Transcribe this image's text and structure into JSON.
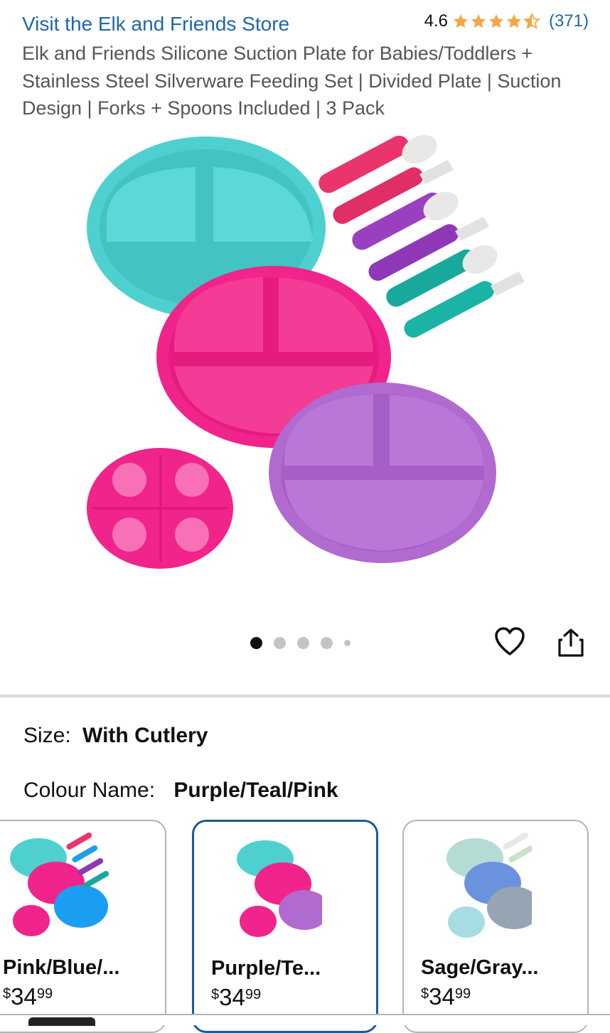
{
  "store_link": "Visit the Elk and Friends Store",
  "rating": {
    "value": "4.6",
    "stars": 4.6,
    "count": "(371)"
  },
  "product_title": "Elk and Friends Silicone Suction Plate for Babies/Toddlers + Stainless Steel Silverware Feeding Set | Divided Plate | Suction Design | Forks + Spoons Included | 3 Pack",
  "carousel": {
    "total": 5,
    "active": 1
  },
  "size": {
    "label": "Size:",
    "value": "With Cutlery"
  },
  "colour": {
    "label": "Colour Name:",
    "value": "Purple/Teal/Pink"
  },
  "swatches": [
    {
      "name": "Pink/Blue/...",
      "currency": "$",
      "price_whole": "34",
      "price_cents": "99"
    },
    {
      "name": "Purple/Te...",
      "currency": "$",
      "price_whole": "34",
      "price_cents": "99"
    },
    {
      "name": "Sage/Gray...",
      "currency": "$",
      "price_whole": "34",
      "price_cents": "99"
    }
  ],
  "colors": {
    "link": "#1f67a8",
    "star": "#f3a847",
    "selected_border": "#1b5b96",
    "teal": "#4fd0d0",
    "pink": "#f0248a",
    "purple": "#b06ad0"
  }
}
